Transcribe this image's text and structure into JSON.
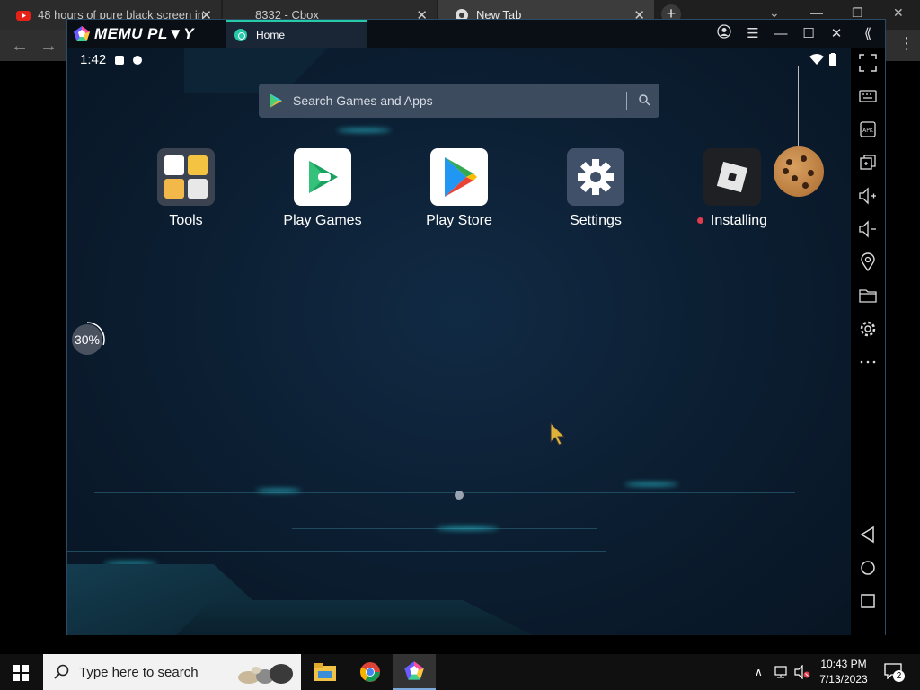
{
  "browser": {
    "tabs": [
      {
        "title": "48 hours of pure black screen in",
        "icon": "youtube-icon"
      },
      {
        "title": "8332 - Cbox",
        "icon": "cbox-icon"
      },
      {
        "title": "New Tab",
        "icon": "chrome-icon"
      }
    ],
    "new_tab_label": "+"
  },
  "memu": {
    "logo_text": "MEMU PL▼Y",
    "home_tab": "Home"
  },
  "android": {
    "status_time": "1:42",
    "search_placeholder": "Search Games and Apps",
    "apps": [
      {
        "label": "Tools",
        "icon": "tools-folder-icon"
      },
      {
        "label": "Play Games",
        "icon": "play-games-icon"
      },
      {
        "label": "Play Store",
        "icon": "play-store-icon"
      },
      {
        "label": "Settings",
        "icon": "settings-gear-icon"
      },
      {
        "label": "Installing",
        "icon": "roblox-icon"
      }
    ],
    "progress_label": "30%",
    "progress_value": 0.3
  },
  "sidebar": [
    "fullscreen-icon",
    "keyboard-icon",
    "apk-icon",
    "multi-instance-icon",
    "volume-up-icon",
    "volume-down-icon",
    "location-icon",
    "folder-icon",
    "gear-icon",
    "more-icon",
    "back-icon",
    "home-icon",
    "recents-icon"
  ],
  "taskbar": {
    "search_placeholder": "Type here to search",
    "time": "10:43 PM",
    "date": "7/13/2023",
    "notif_count": "2"
  },
  "colors": {
    "accent": "#26c9a8",
    "screen_bg": "#0b1d30",
    "search_bg": "#3d4b5e"
  }
}
